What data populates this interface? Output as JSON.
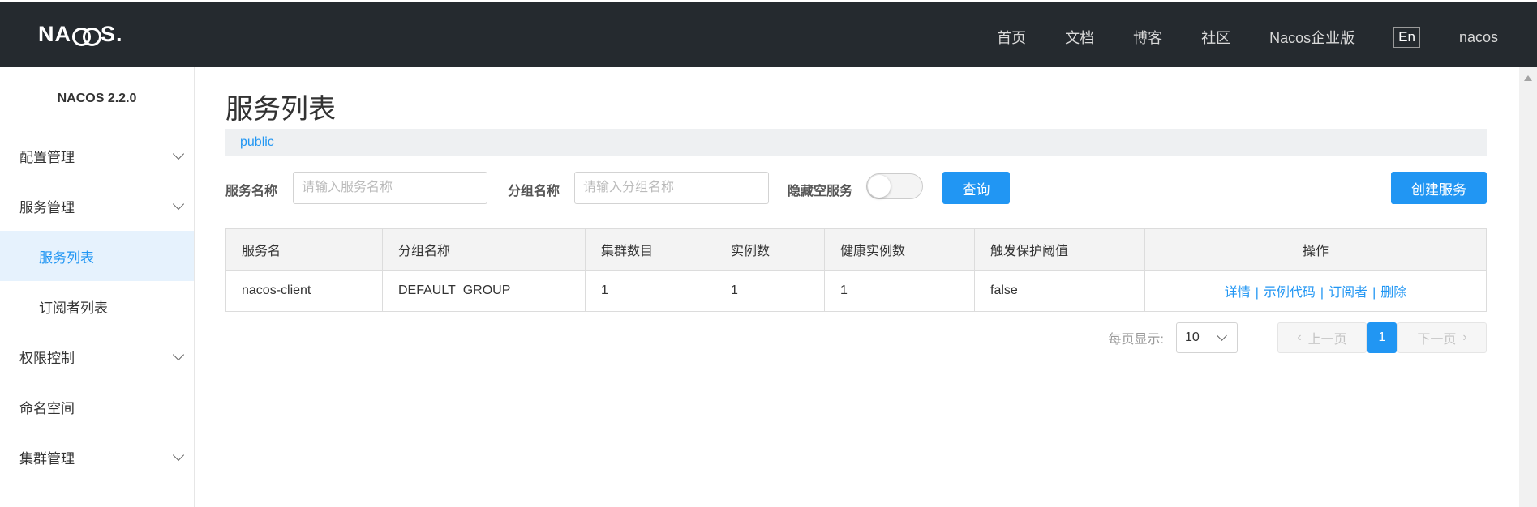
{
  "header": {
    "logo": "NACOS.",
    "logo_parts": [
      "NA",
      "S"
    ],
    "nav": [
      "首页",
      "文档",
      "博客",
      "社区",
      "Nacos企业版"
    ],
    "lang": "En",
    "user": "nacos"
  },
  "sidebar": {
    "version": "NACOS 2.2.0",
    "items": {
      "config": "配置管理",
      "service": "服务管理",
      "service_list": "服务列表",
      "subscriber_list": "订阅者列表",
      "auth": "权限控制",
      "namespace": "命名空间",
      "cluster": "集群管理"
    }
  },
  "main": {
    "title": "服务列表",
    "namespace": "public",
    "filters": {
      "service_label": "服务名称",
      "service_placeholder": "请输入服务名称",
      "group_label": "分组名称",
      "group_placeholder": "请输入分组名称",
      "hide_empty_label": "隐藏空服务",
      "hide_empty_on": false,
      "query_button": "查询",
      "create_button": "创建服务"
    },
    "table": {
      "headers": [
        "服务名",
        "分组名称",
        "集群数目",
        "实例数",
        "健康实例数",
        "触发保护阈值",
        "操作"
      ],
      "rows": [
        {
          "name": "nacos-client",
          "group": "DEFAULT_GROUP",
          "clusters": "1",
          "instances": "1",
          "healthy": "1",
          "threshold": "false",
          "ops": [
            "详情",
            "示例代码",
            "订阅者",
            "删除"
          ]
        }
      ]
    },
    "pagination": {
      "page_size_label": "每页显示:",
      "page_size": "10",
      "prev": "上一页",
      "current": "1",
      "next": "下一页"
    }
  },
  "colors": {
    "header_bg": "#252a2f",
    "accent": "#2196f3",
    "active_bg": "#e6f2fd"
  }
}
